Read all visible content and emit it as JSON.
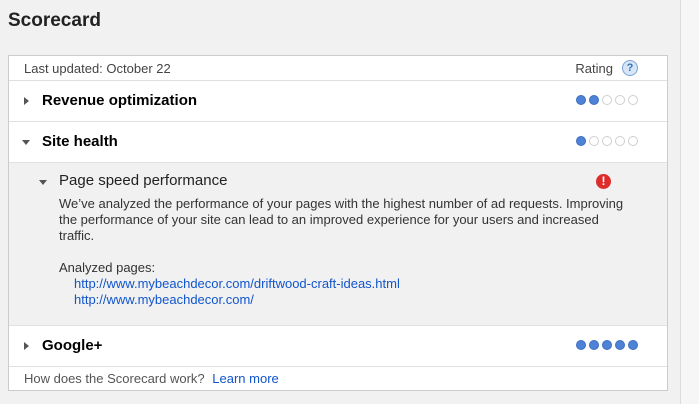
{
  "page": {
    "title": "Scorecard"
  },
  "scorecard": {
    "last_updated": "Last updated: October 22",
    "rating_label": "Rating",
    "help_glyph": "?",
    "categories": [
      {
        "label": "Revenue optimization",
        "rating": 2,
        "max": 5,
        "expanded": false
      },
      {
        "label": "Site health",
        "rating": 1,
        "max": 5,
        "expanded": true
      },
      {
        "label": "Google+",
        "rating": 5,
        "max": 5,
        "expanded": false
      }
    ],
    "site_health_detail": {
      "sub_label": "Page speed performance",
      "alert_glyph": "!",
      "description": "We’ve analyzed the performance of your pages with the highest number of ad requests. Improving the performance of your site can lead to an improved experience for your users and increased traffic.",
      "analyzed_label": "Analyzed pages:",
      "pages": [
        "http://www.mybeachdecor.com/driftwood-craft-ideas.html",
        "http://www.mybeachdecor.com/"
      ]
    },
    "footer": {
      "question": "How does the Scorecard work?",
      "link": "Learn more"
    }
  },
  "colors": {
    "dot_on": "#4d82d6",
    "dot_off": "#ffffff",
    "alert": "#dd2c2c",
    "link": "#1155cc"
  }
}
